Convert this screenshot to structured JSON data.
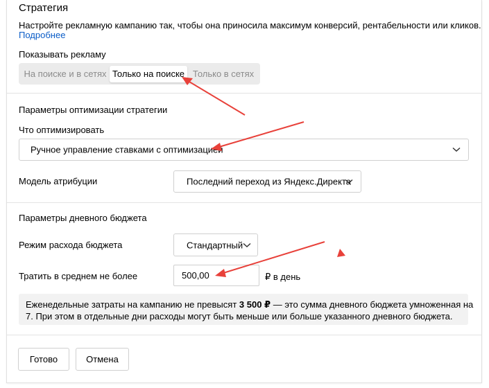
{
  "strategy": {
    "title": "Стратегия",
    "description": "Настройте рекламную кампанию так, чтобы она приносила максимум конверсий, рентабельности или кликов.",
    "more_link": "Подробнее",
    "show_ads_label": "Показывать рекламу",
    "show_ads_options": [
      "На поиске и в сетях",
      "Только на поиске",
      "Только в сетях"
    ],
    "show_ads_selected": "Только на поиске"
  },
  "optimization": {
    "title": "Параметры оптимизации стратегии",
    "what_label": "Что оптимизировать",
    "what_value": "Ручное управление ставками с оптимизацией",
    "attribution_label": "Модель атрибуции",
    "attribution_value": "Последний переход из Яндекс.Директа"
  },
  "budget": {
    "title": "Параметры дневного бюджета",
    "mode_label": "Режим расхода бюджета",
    "mode_value": "Стандартный",
    "spend_label": "Тратить в среднем не более",
    "spend_value": "500,00",
    "spend_unit": "₽ в день",
    "info_pre": "Еженедельные затраты на кампанию не превысят ",
    "info_bold": "3 500 ₽",
    "info_line1_post": " — это сумма дневного бюджета умноженная на",
    "info_line2": "7. При этом в отдельные дни расходы могут быть меньше или больше указанного дневного бюджета."
  },
  "footer": {
    "done_label": "Готово",
    "cancel_label": "Отмена"
  },
  "colors": {
    "link": "#0a5cc7",
    "annotation_arrow": "#e8413a",
    "segment_bg": "#ebebeb",
    "info_bg": "#f2f2f2"
  }
}
